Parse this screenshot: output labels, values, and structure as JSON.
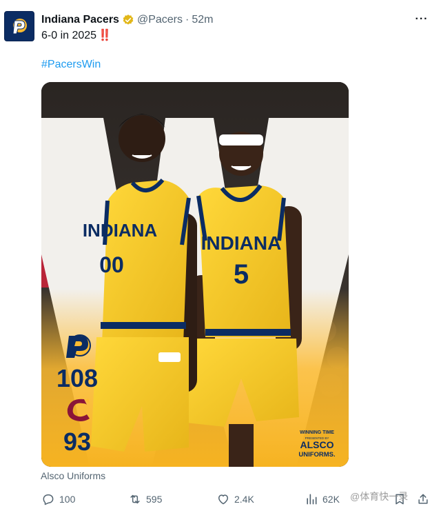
{
  "tweet": {
    "author_name": "Indiana Pacers",
    "handle": "@Pacers",
    "separator": "·",
    "time": "52m",
    "text": "6-0 in 2025",
    "text_emoji": "‼️",
    "hashtag": "#PacersWin",
    "more_icon": "more-horizontal-icon",
    "media": {
      "jersey_brand": "INDIANA",
      "left_player_number": "00",
      "right_player_number": "5",
      "pacers_score": "108",
      "cavaliers_score": "93",
      "sponsor_line1": "WINNING TIME",
      "sponsor_line2": "PRESENTED BY",
      "sponsor_line3": "ALSCO",
      "sponsor_line4": "UNIFORMS."
    },
    "media_label": "Alsco Uniforms",
    "actions": {
      "replies": "100",
      "retweets": "595",
      "likes": "2.4K",
      "views": "62K"
    },
    "watermark": "@体育快一录"
  },
  "colors": {
    "pacers_navy": "#0b2c63",
    "pacers_gold": "#fdbb30",
    "jersey_yellow": "#f3c424",
    "link_blue": "#1d9bf0",
    "muted_gray": "#536471",
    "emoji_red": "#e0263a"
  }
}
